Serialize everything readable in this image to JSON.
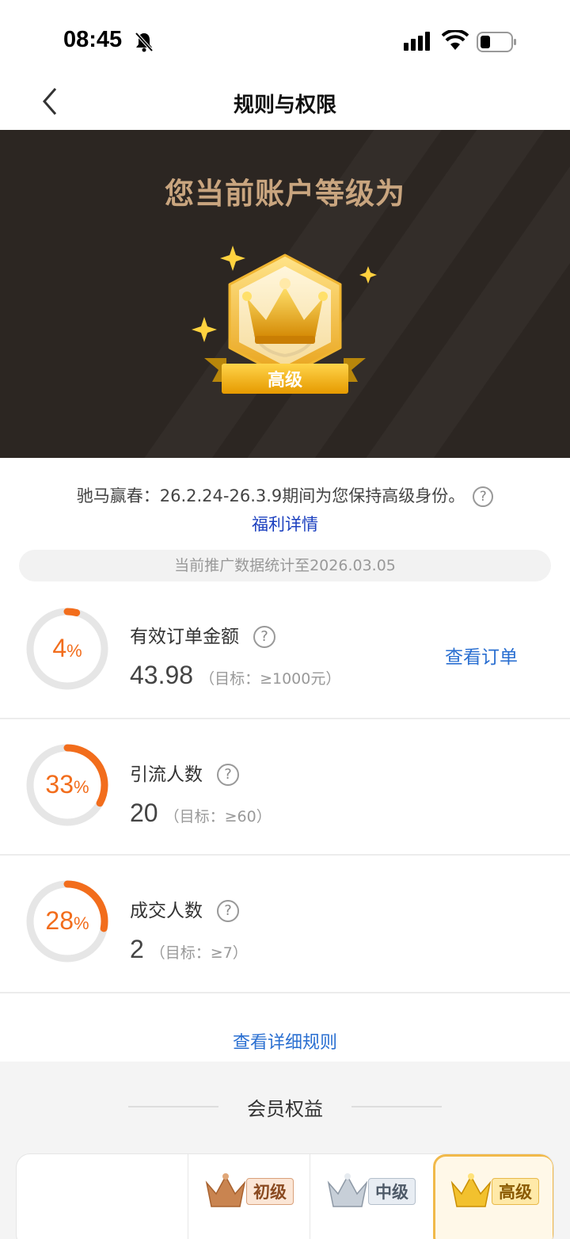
{
  "status_bar": {
    "time": "08:45"
  },
  "nav": {
    "title": "规则与权限"
  },
  "hero": {
    "title": "您当前账户等级为",
    "level": "高级"
  },
  "promo": {
    "text": "驰马赢春：26.2.24-26.3.9期间为您保持高级身份。",
    "help": "?",
    "link": "福利详情"
  },
  "stats_date": "当前推广数据统计至2026.03.05",
  "metrics": [
    {
      "label": "有效订单金额",
      "help": "?",
      "percent": 4,
      "percent_text": "4",
      "value": "43.98",
      "target": "（目标：≥1000元）",
      "action": "查看订单"
    },
    {
      "label": "引流人数",
      "help": "?",
      "percent": 33,
      "percent_text": "33",
      "value": "20",
      "target": "（目标：≥60）"
    },
    {
      "label": "成交人数",
      "help": "?",
      "percent": 28,
      "percent_text": "28",
      "value": "2",
      "target": "（目标：≥7）"
    }
  ],
  "percent_sign": "%",
  "rules_link": "查看详细规则",
  "members": {
    "title": "会员权益",
    "tiers": [
      {
        "label": "初级"
      },
      {
        "label": "中级"
      },
      {
        "label": "高级"
      }
    ]
  },
  "colors": {
    "accent_orange": "#f26d1c",
    "link_blue": "#2a6fd1",
    "gold": "#c9a57f"
  }
}
